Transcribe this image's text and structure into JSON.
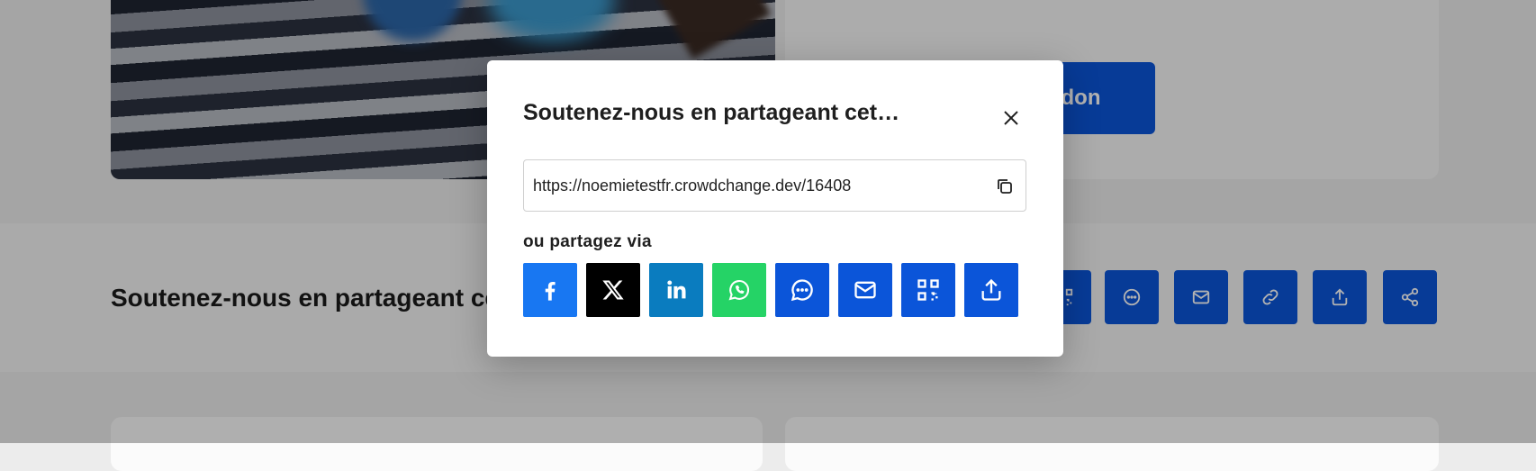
{
  "background": {
    "donate_button_label": "un don",
    "share_strip_title": "Soutenez-nous en partageant cet événement",
    "share_strip_icons": [
      "qr-code-icon",
      "chat-bubble-icon",
      "mail-icon",
      "link-icon",
      "share-upload-icon",
      "share-nodes-icon"
    ]
  },
  "modal": {
    "title": "Soutenez-nous en partageant cet événement",
    "close_icon": "close-icon",
    "share_url": "https://noemietestfr.crowdchange.dev/16408",
    "copy_icon": "copy-icon",
    "share_via_label": "ou partagez via",
    "share_buttons": [
      {
        "name": "facebook",
        "icon": "facebook-icon",
        "color": "#1877f2"
      },
      {
        "name": "x",
        "icon": "x-icon",
        "color": "#000000"
      },
      {
        "name": "linkedin",
        "icon": "linkedin-icon",
        "color": "#0a7cbf"
      },
      {
        "name": "whatsapp",
        "icon": "whatsapp-icon",
        "color": "#25d366"
      },
      {
        "name": "sms",
        "icon": "chat-bubble-icon",
        "color": "#0b55d9"
      },
      {
        "name": "email",
        "icon": "mail-icon",
        "color": "#0b55d9"
      },
      {
        "name": "qr-code",
        "icon": "qr-code-icon",
        "color": "#0b55d9"
      },
      {
        "name": "native-share",
        "icon": "share-upload-icon",
        "color": "#0b55d9"
      }
    ]
  },
  "colors": {
    "accent": "#0b55d9",
    "overlay": "rgba(0,0,0,0.30)"
  }
}
